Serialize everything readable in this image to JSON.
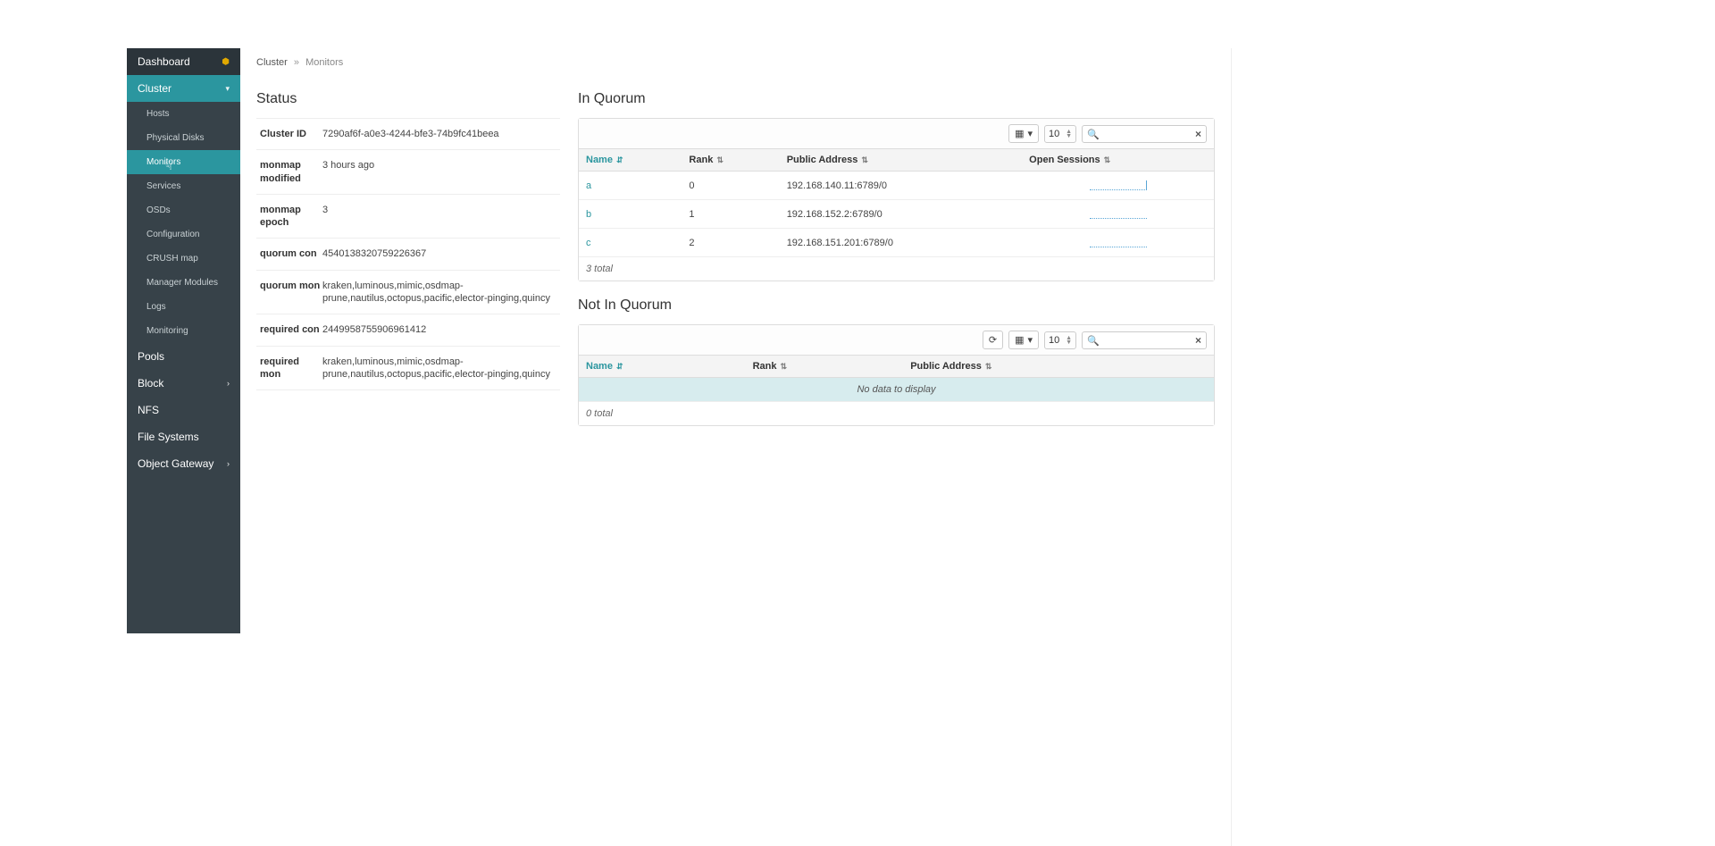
{
  "sidebar": {
    "dashboard": "Dashboard",
    "cluster": "Cluster",
    "items": [
      {
        "label": "Hosts"
      },
      {
        "label": "Physical Disks"
      },
      {
        "label": "Monitors"
      },
      {
        "label": "Services"
      },
      {
        "label": "OSDs"
      },
      {
        "label": "Configuration"
      },
      {
        "label": "CRUSH map"
      },
      {
        "label": "Manager Modules"
      },
      {
        "label": "Logs"
      },
      {
        "label": "Monitoring"
      }
    ],
    "pools": "Pools",
    "block": "Block",
    "nfs": "NFS",
    "fs": "File Systems",
    "og": "Object Gateway"
  },
  "breadcrumb": {
    "root": "Cluster",
    "current": "Monitors"
  },
  "status": {
    "title": "Status",
    "rows": [
      {
        "k": "Cluster ID",
        "v": "7290af6f-a0e3-4244-bfe3-74b9fc41beea"
      },
      {
        "k": "monmap modified",
        "v": "3 hours ago"
      },
      {
        "k": "monmap epoch",
        "v": "3"
      },
      {
        "k": "quorum con",
        "v": "4540138320759226367"
      },
      {
        "k": "quorum mon",
        "v": "kraken,luminous,mimic,osdmap-prune,nautilus,octopus,pacific,elector-pinging,quincy"
      },
      {
        "k": "required con",
        "v": "2449958755906961412"
      },
      {
        "k": "required mon",
        "v": "kraken,luminous,mimic,osdmap-prune,nautilus,octopus,pacific,elector-pinging,quincy"
      }
    ]
  },
  "in_quorum": {
    "title": "In Quorum",
    "page_size": "10",
    "columns": {
      "name": "Name",
      "rank": "Rank",
      "addr": "Public Address",
      "sessions": "Open Sessions"
    },
    "rows": [
      {
        "name": "a",
        "rank": "0",
        "addr": "192.168.140.11:6789/0"
      },
      {
        "name": "b",
        "rank": "1",
        "addr": "192.168.152.2:6789/0"
      },
      {
        "name": "c",
        "rank": "2",
        "addr": "192.168.151.201:6789/0"
      }
    ],
    "footer": "3 total"
  },
  "not_in_quorum": {
    "title": "Not In Quorum",
    "page_size": "10",
    "columns": {
      "name": "Name",
      "rank": "Rank",
      "addr": "Public Address"
    },
    "empty": "No data to display",
    "footer": "0 total"
  }
}
